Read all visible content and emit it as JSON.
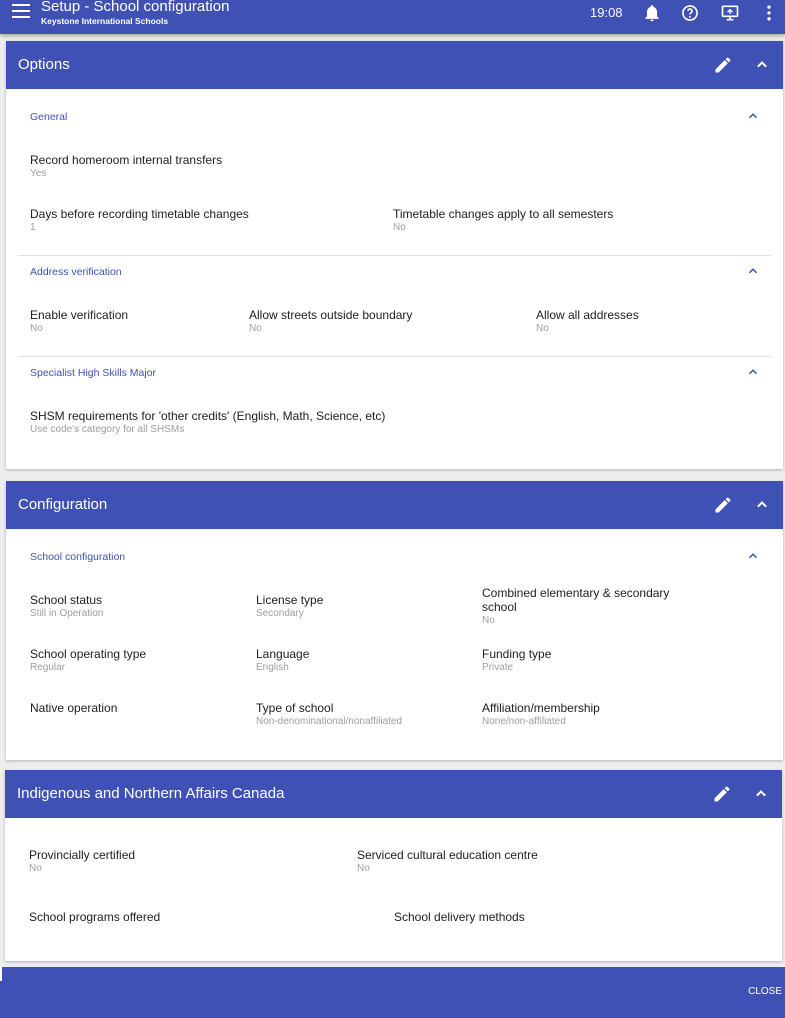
{
  "appbar": {
    "title": "Setup - School configuration",
    "subtitle": "Keystone International Schools",
    "time": "19:08",
    "icons": [
      "menu-icon",
      "bell-icon",
      "help-icon",
      "screen-share-icon",
      "more-vert-icon"
    ],
    "color": "#3f51b5"
  },
  "options": {
    "title": "Options",
    "general": {
      "title": "General",
      "record_homeroom": {
        "label": "Record homeroom internal transfers",
        "value": "Yes"
      },
      "days_before": {
        "label": "Days before recording timetable changes",
        "value": "1"
      },
      "timetable_apply": {
        "label": "Timetable changes apply to all semesters",
        "value": "No"
      }
    },
    "address": {
      "title": "Address verification",
      "enable": {
        "label": "Enable verification",
        "value": "No"
      },
      "allow_streets": {
        "label": "Allow streets outside boundary",
        "value": "No"
      },
      "allow_all": {
        "label": "Allow all addresses",
        "value": "No"
      }
    },
    "shsm": {
      "title": "Specialist High Skills Major",
      "requirements": {
        "label": "SHSM requirements for 'other credits' (English, Math, Science, etc)",
        "value": "Use code's category for all SHSMs"
      }
    }
  },
  "configuration": {
    "title": "Configuration",
    "school_config": {
      "title": "School configuration",
      "school_status": {
        "label": "School status",
        "value": "Still in Operation"
      },
      "license_type": {
        "label": "License type",
        "value": "Secondary"
      },
      "combined": {
        "label": "Combined elementary & secondary school",
        "value": "No"
      },
      "operating_type": {
        "label": "School operating type",
        "value": "Regular"
      },
      "language": {
        "label": "Language",
        "value": "English"
      },
      "funding_type": {
        "label": "Funding type",
        "value": "Private"
      },
      "native_operation": {
        "label": "Native operation",
        "value": ""
      },
      "type_of_school": {
        "label": "Type of school",
        "value": "Non-denominational/nonaffiliated"
      },
      "affiliation": {
        "label": "Affiliation/membership",
        "value": "None/non-affiliated"
      }
    }
  },
  "inac": {
    "title": "Indigenous and Northern Affairs Canada",
    "provincially_certified": {
      "label": "Provincially certified",
      "value": "No"
    },
    "serviced_centre": {
      "label": "Serviced cultural education centre",
      "value": "No"
    },
    "programs_offered": {
      "label": "School programs offered",
      "value": ""
    },
    "delivery_methods": {
      "label": "School delivery methods",
      "value": ""
    }
  },
  "footer": {
    "close_label": "CLOSE"
  }
}
